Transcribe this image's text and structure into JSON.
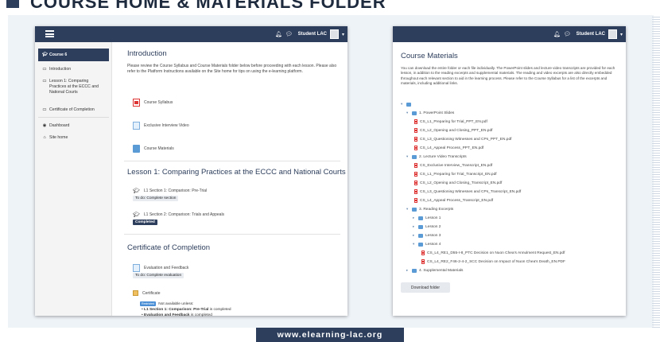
{
  "banner": {
    "title": "COURSE HOME & MATERIALS FOLDER"
  },
  "footer": {
    "url": "www.elearning-lac.org"
  },
  "colors": {
    "navy": "#2d3e5c",
    "pdf_red": "#dd3333",
    "folder_blue": "#5b9bd5"
  },
  "topbar": {
    "bell_icon": "bell-icon",
    "chat_icon": "chat-icon",
    "user": "Student LAC",
    "caret": "▾"
  },
  "sidebar": {
    "items": [
      {
        "label": "Course 6",
        "icon": "graduation-cap-icon"
      },
      {
        "label": "Introduction",
        "icon": "folder-outline-icon"
      },
      {
        "label": "Lesson 1: Comparing Practices at the ECCC and National Courts",
        "icon": "folder-outline-icon"
      },
      {
        "label": "Certificate of Completion",
        "icon": "folder-outline-icon"
      },
      {
        "label": "Dashboard",
        "icon": "dashboard-icon"
      },
      {
        "label": "Site home",
        "icon": "home-icon"
      }
    ]
  },
  "course": {
    "intro_title": "Introduction",
    "intro_text": "Please review the Course Syllabus and Course Materials folder below before proceeding with each lesson. Please also refer to the Platform Instructions available on the Site home for tips on using the e-learning platform.",
    "intro_items": [
      "Course Syllabus",
      "Exclusive Interview Video",
      "Course Materials"
    ],
    "lesson_title": "Lesson 1: Comparing Practices at the ECCC and National Courts",
    "lesson_items": [
      {
        "label": "L1 Section 1: Comparison: Pre-Trial",
        "status": "To do: Complete section"
      },
      {
        "label": "L1 Section 2: Comparison: Trials and Appeals",
        "status": "Completed"
      }
    ],
    "cert_title": "Certificate of Completion",
    "cert_items": [
      {
        "label": "Evaluation and Feedback",
        "status": "To do: Complete evaluation"
      },
      {
        "label": "Certificate"
      }
    ],
    "restricted_badge": "Restricted",
    "not_available": "Not available unless:",
    "conditions": [
      {
        "bold": "L1 Section 1: Comparison: Pre-Trial",
        "rest": " is completed"
      },
      {
        "bold": "Evaluation and Feedback",
        "rest": " is completed"
      }
    ]
  },
  "materials": {
    "title": "Course Materials",
    "description": "You can download the entire folder or each file individually. The PowerPoint slides and lecture video transcripts are provided for each lesson, in addition to the reading excerpts and supplemental materials. The reading and video excerpts are also directly embedded throughout each relevant section to aid in the learning process. Please refer to the Course Syllabus for a list of the excerpts and materials, including additional links.",
    "tree": {
      "f1": "1. PowerPoint Slides",
      "f1_files": [
        "CS_L1_Preparing for Trial_PPT_EN.pdf",
        "CS_L2_Opening and Closing_PPT_EN.pdf",
        "CS_L3_Questioning Witnesses and CPs_PPT_EN.pdf",
        "CS_L4_Appeal Process_PPT_EN.pdf"
      ],
      "f2": "2. Lecture Video Transcripts",
      "f2_files": [
        "CS_Exclusive Interview_Transcript_EN.pdf",
        "CS_L1_Preparing for Trial_Transcript_EN.pdf",
        "CS_L2_Opening and Closing_Transcript_EN.pdf",
        "CS_L3_Questioning Witnesses and CPs_Transcript_EN.pdf",
        "CS_L4_Appeal Process_Transcript_EN.pdf"
      ],
      "f3": "3. Reading Excerpts",
      "f3_sub": [
        "Lesson 1",
        "Lesson 2",
        "Lesson 3",
        "Lesson 4"
      ],
      "f3_l4_files": [
        "CS_L4_RE1_D55-I-8_PTC Decision on Nuon Chea's Annulment Request_EN.pdf",
        "CS_L4_RE2_F46-2-4-2_SCC Decision on Impact of Nuon Chea's Death_EN.PDF"
      ],
      "f4": "4. Supplemental Materials"
    },
    "download_label": "Download folder"
  }
}
